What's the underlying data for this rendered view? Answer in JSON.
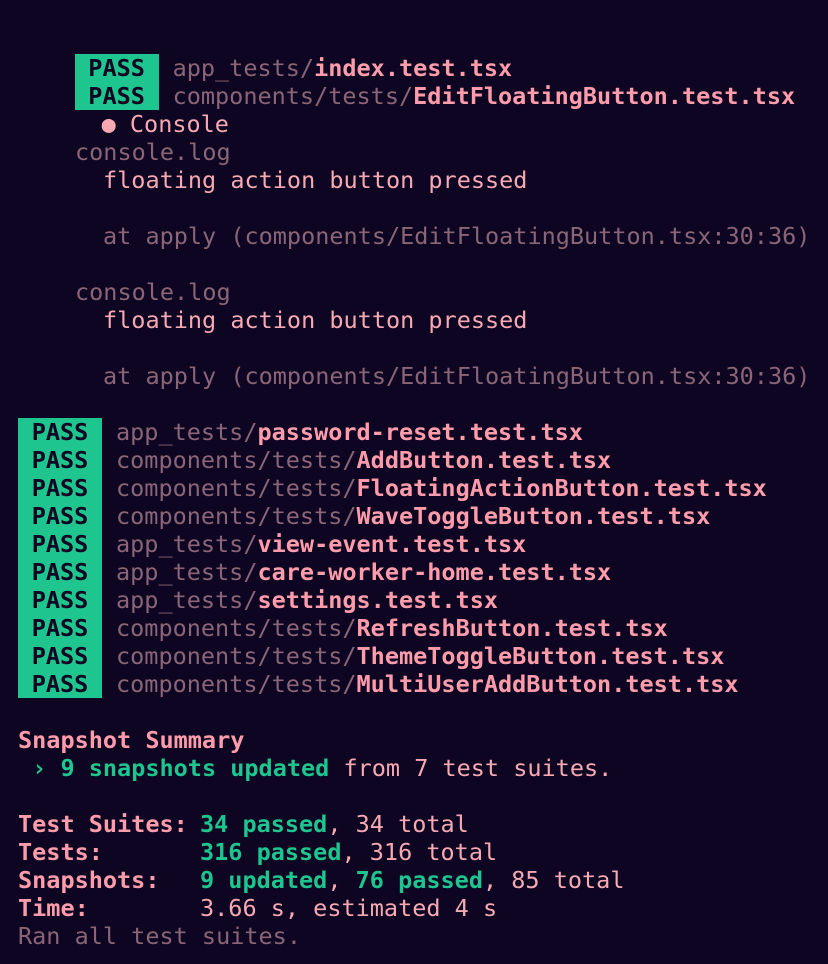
{
  "badge": "PASS",
  "first_results": [
    {
      "dir": "app_tests/",
      "file": "index.test.tsx"
    },
    {
      "dir": "components/tests/",
      "file": "EditFloatingButton.test.tsx"
    }
  ],
  "console": {
    "bullet": "●",
    "title": "Console",
    "logs": [
      {
        "header": "console.log",
        "message": "floating action button pressed",
        "trace": "at apply (components/EditFloatingButton.tsx:30:36)"
      },
      {
        "header": "console.log",
        "message": "floating action button pressed",
        "trace": "at apply (components/EditFloatingButton.tsx:30:36)"
      }
    ]
  },
  "results": [
    {
      "dir": "app_tests/",
      "file": "password-reset.test.tsx"
    },
    {
      "dir": "components/tests/",
      "file": "AddButton.test.tsx"
    },
    {
      "dir": "components/tests/",
      "file": "FloatingActionButton.test.tsx"
    },
    {
      "dir": "components/tests/",
      "file": "WaveToggleButton.test.tsx"
    },
    {
      "dir": "app_tests/",
      "file": "view-event.test.tsx"
    },
    {
      "dir": "app_tests/",
      "file": "care-worker-home.test.tsx"
    },
    {
      "dir": "app_tests/",
      "file": "settings.test.tsx"
    },
    {
      "dir": "components/tests/",
      "file": "RefreshButton.test.tsx"
    },
    {
      "dir": "components/tests/",
      "file": "ThemeToggleButton.test.tsx"
    },
    {
      "dir": "components/tests/",
      "file": "MultiUserAddButton.test.tsx"
    }
  ],
  "snapshot_summary": {
    "title": "Snapshot Summary",
    "arrow": "›",
    "updated": "9 snapshots updated",
    "rest": "from 7 test suites."
  },
  "summary": {
    "suites": {
      "label": "Test Suites:",
      "passed": "34 passed",
      "total": ", 34 total"
    },
    "tests": {
      "label": "Tests:",
      "passed": "316 passed",
      "total": ", 316 total"
    },
    "snapshots": {
      "label": "Snapshots:",
      "updated": "9 updated",
      "sep": ", ",
      "passed": "76 passed",
      "total": ", 85 total"
    },
    "time": {
      "label": "Time:",
      "value": "3.66 s, estimated 4 s"
    },
    "footer": "Ran all test suites."
  }
}
